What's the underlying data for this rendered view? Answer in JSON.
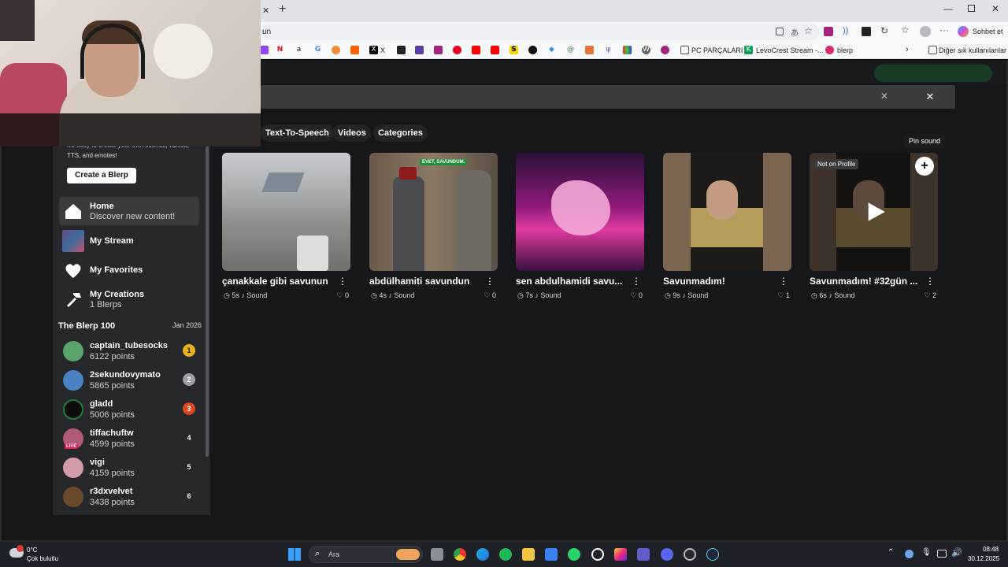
{
  "browser": {
    "url_fragment": "un",
    "copilot_label": "Sohbet et",
    "bookmarks": [
      {
        "label": "X",
        "icon": "x-icon"
      },
      {
        "label": "PC PARÇALARI",
        "icon": "folder-icon"
      },
      {
        "label": "LevoCrest Stream -...",
        "icon": "levocrest-icon"
      },
      {
        "label": "blerp",
        "icon": "blerp-icon"
      }
    ],
    "other_bookmarks": "Diğer sık kullanılanlar"
  },
  "filters": [
    "Text-To-Speech",
    "Videos",
    "Categories"
  ],
  "tooltip": "Pin sound",
  "sidebar": {
    "promo_text": "It's easy to create your own sounds, videos, TTS, and emotes!",
    "create_button": "Create a Blerp",
    "nav": [
      {
        "title": "Home",
        "subtitle": "Discover new content!",
        "icon": "home-icon"
      },
      {
        "title": "My Stream",
        "subtitle": "",
        "icon": "stream-icon"
      },
      {
        "title": "My Favorites",
        "subtitle": "",
        "icon": "heart-icon"
      },
      {
        "title": "My Creations",
        "subtitle": "1 Blerps",
        "icon": "hammer-icon"
      }
    ],
    "leaderboard_title": "The Blerp 100",
    "leaderboard_date": "Jan 2026",
    "leaderboard": [
      {
        "name": "captain_tubesocks",
        "points": "6122 points",
        "rank": "1",
        "rank_color": "#e9b11c"
      },
      {
        "name": "2sekundovymato",
        "points": "5865 points",
        "rank": "2",
        "rank_color": "#9aa0a6"
      },
      {
        "name": "gladd",
        "points": "5006 points",
        "rank": "3",
        "rank_color": "#d9481e"
      },
      {
        "name": "tiffachuftw",
        "points": "4599 points",
        "rank": "4",
        "rank_color": "#27282b"
      },
      {
        "name": "vigi",
        "points": "4159 points",
        "rank": "5",
        "rank_color": "#27282b"
      },
      {
        "name": "r3dxvelvet",
        "points": "3438 points",
        "rank": "6",
        "rank_color": "#27282b"
      }
    ],
    "live_badge": "LIVE"
  },
  "cards": [
    {
      "title": "çanakkale gibi savunun",
      "duration": "5s",
      "type": "Sound",
      "likes": "0"
    },
    {
      "title": "abdülhamiti savundun",
      "duration": "4s",
      "type": "Sound",
      "likes": "0",
      "overlay": "EVET, SAVUNDUM."
    },
    {
      "title": "sen abdulhamidi savu...",
      "duration": "7s",
      "type": "Sound",
      "likes": "0"
    },
    {
      "title": "Savunmadım!",
      "duration": "9s",
      "type": "Sound",
      "likes": "1"
    },
    {
      "title": "Savunmadım! #32gün ...",
      "duration": "6s",
      "type": "Sound",
      "likes": "2",
      "badge": "Not on Profile"
    }
  ],
  "taskbar": {
    "weather_temp": "0°C",
    "weather_desc": "Çok bulutlu",
    "search_placeholder": "Ara",
    "time": "08:48",
    "date": "30.12.2025"
  },
  "colors": {
    "accent_green": "#2fb24c",
    "page_bg": "#16171a",
    "sidebar_bg": "#27282b"
  }
}
